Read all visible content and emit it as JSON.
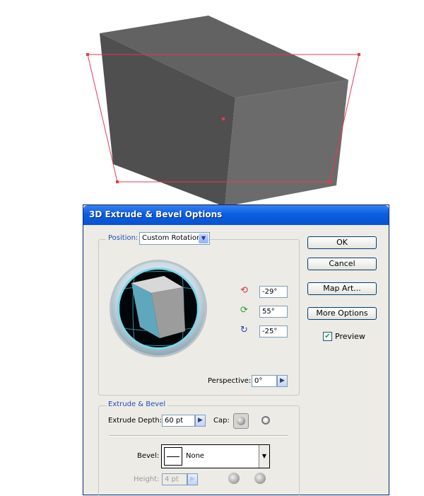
{
  "dialog": {
    "title": "3D Extrude & Bevel Options",
    "position": {
      "label": "Position:",
      "value": "Custom Rotation",
      "rotations": [
        {
          "axis": "x",
          "value": "-29°"
        },
        {
          "axis": "y",
          "value": "55°"
        },
        {
          "axis": "z",
          "value": "-25°"
        }
      ],
      "perspective_label": "Perspective:",
      "perspective_value": "0°"
    },
    "extrude_bevel": {
      "legend": "Extrude & Bevel",
      "depth_label": "Extrude Depth:",
      "depth_value": "60 pt",
      "cap_label": "Cap:",
      "bevel_label": "Bevel:",
      "bevel_value": "None",
      "height_label": "Height:",
      "height_value": "4 pt"
    },
    "buttons": {
      "ok": "OK",
      "cancel": "Cancel",
      "map_art": "Map Art...",
      "more_options": "More Options"
    },
    "preview": {
      "label": "Preview",
      "checked": true
    },
    "colors": {
      "title_bar": "#0a5fe0",
      "cube_side": "#5fa7bd",
      "selection": "#e8384f"
    }
  }
}
